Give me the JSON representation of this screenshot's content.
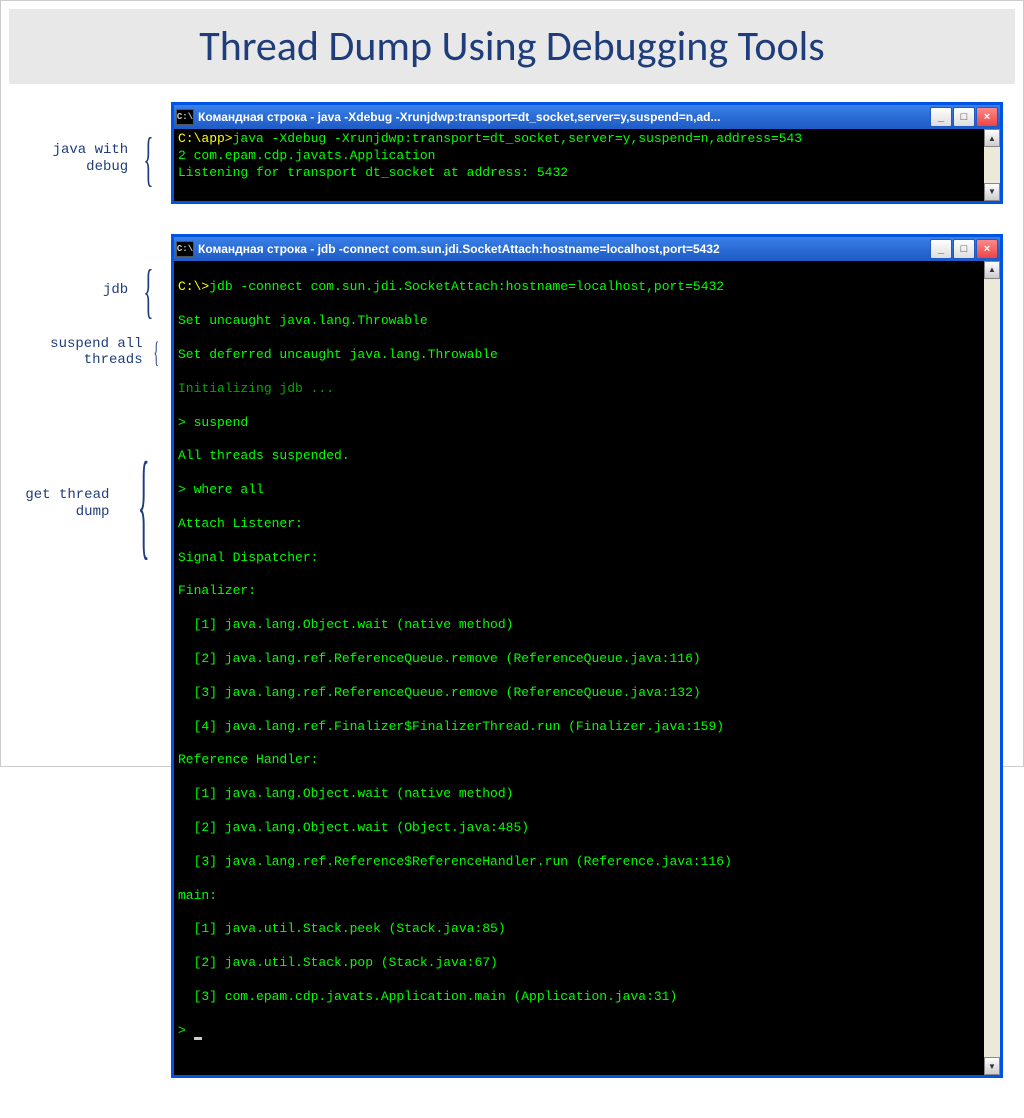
{
  "title": "Thread Dump Using Debugging Tools",
  "labels": {
    "java_debug": "java with\ndebug",
    "jdb": "jdb",
    "suspend": "suspend all\nthreads",
    "dump": "get thread\ndump"
  },
  "window1": {
    "icon": "C:\\",
    "title": "Командная строка - java -Xdebug -Xrunjdwp:transport=dt_socket,server=y,suspend=n,ad...",
    "btn_min": "_",
    "btn_max": "□",
    "btn_close": "×",
    "scroll_up": "▲",
    "scroll_down": "▼",
    "lines": [
      {
        "prompt": "C:\\app>",
        "text": "java -Xdebug -Xrunjdwp:transport=dt_socket,server=y,suspend=n,address=543"
      },
      {
        "text": "2 com.epam.cdp.javats.Application"
      },
      {
        "text": "Listening for transport dt_socket at address: 5432"
      }
    ]
  },
  "window2": {
    "icon": "C:\\",
    "title": "Командная строка - jdb -connect com.sun.jdi.SocketAttach:hostname=localhost,port=5432",
    "btn_min": "_",
    "btn_max": "□",
    "btn_close": "×",
    "scroll_up": "▲",
    "scroll_down": "▼",
    "line1_prompt": "C:\\>",
    "line1_text": "jdb -connect com.sun.jdi.SocketAttach:hostname=localhost,port=5432",
    "line2": "Set uncaught java.lang.Throwable",
    "line3": "Set deferred uncaught java.lang.Throwable",
    "line4": "Initializing jdb ...",
    "line5": "> suspend",
    "line6": "All threads suspended.",
    "line7": "> where all",
    "line8": "Attach Listener:",
    "line9": "Signal Dispatcher:",
    "line10": "Finalizer:",
    "line11": "  [1] java.lang.Object.wait (native method)",
    "line12": "  [2] java.lang.ref.ReferenceQueue.remove (ReferenceQueue.java:116)",
    "line13": "  [3] java.lang.ref.ReferenceQueue.remove (ReferenceQueue.java:132)",
    "line14": "  [4] java.lang.ref.Finalizer$FinalizerThread.run (Finalizer.java:159)",
    "line15": "Reference Handler:",
    "line16": "  [1] java.lang.Object.wait (native method)",
    "line17": "  [2] java.lang.Object.wait (Object.java:485)",
    "line18": "  [3] java.lang.ref.Reference$ReferenceHandler.run (Reference.java:116)",
    "line19": "main:",
    "line20": "  [1] java.util.Stack.peek (Stack.java:85)",
    "line21": "  [2] java.util.Stack.pop (Stack.java:67)",
    "line22": "  [3] com.epam.cdp.javats.Application.main (Application.java:31)",
    "line23": "> "
  }
}
